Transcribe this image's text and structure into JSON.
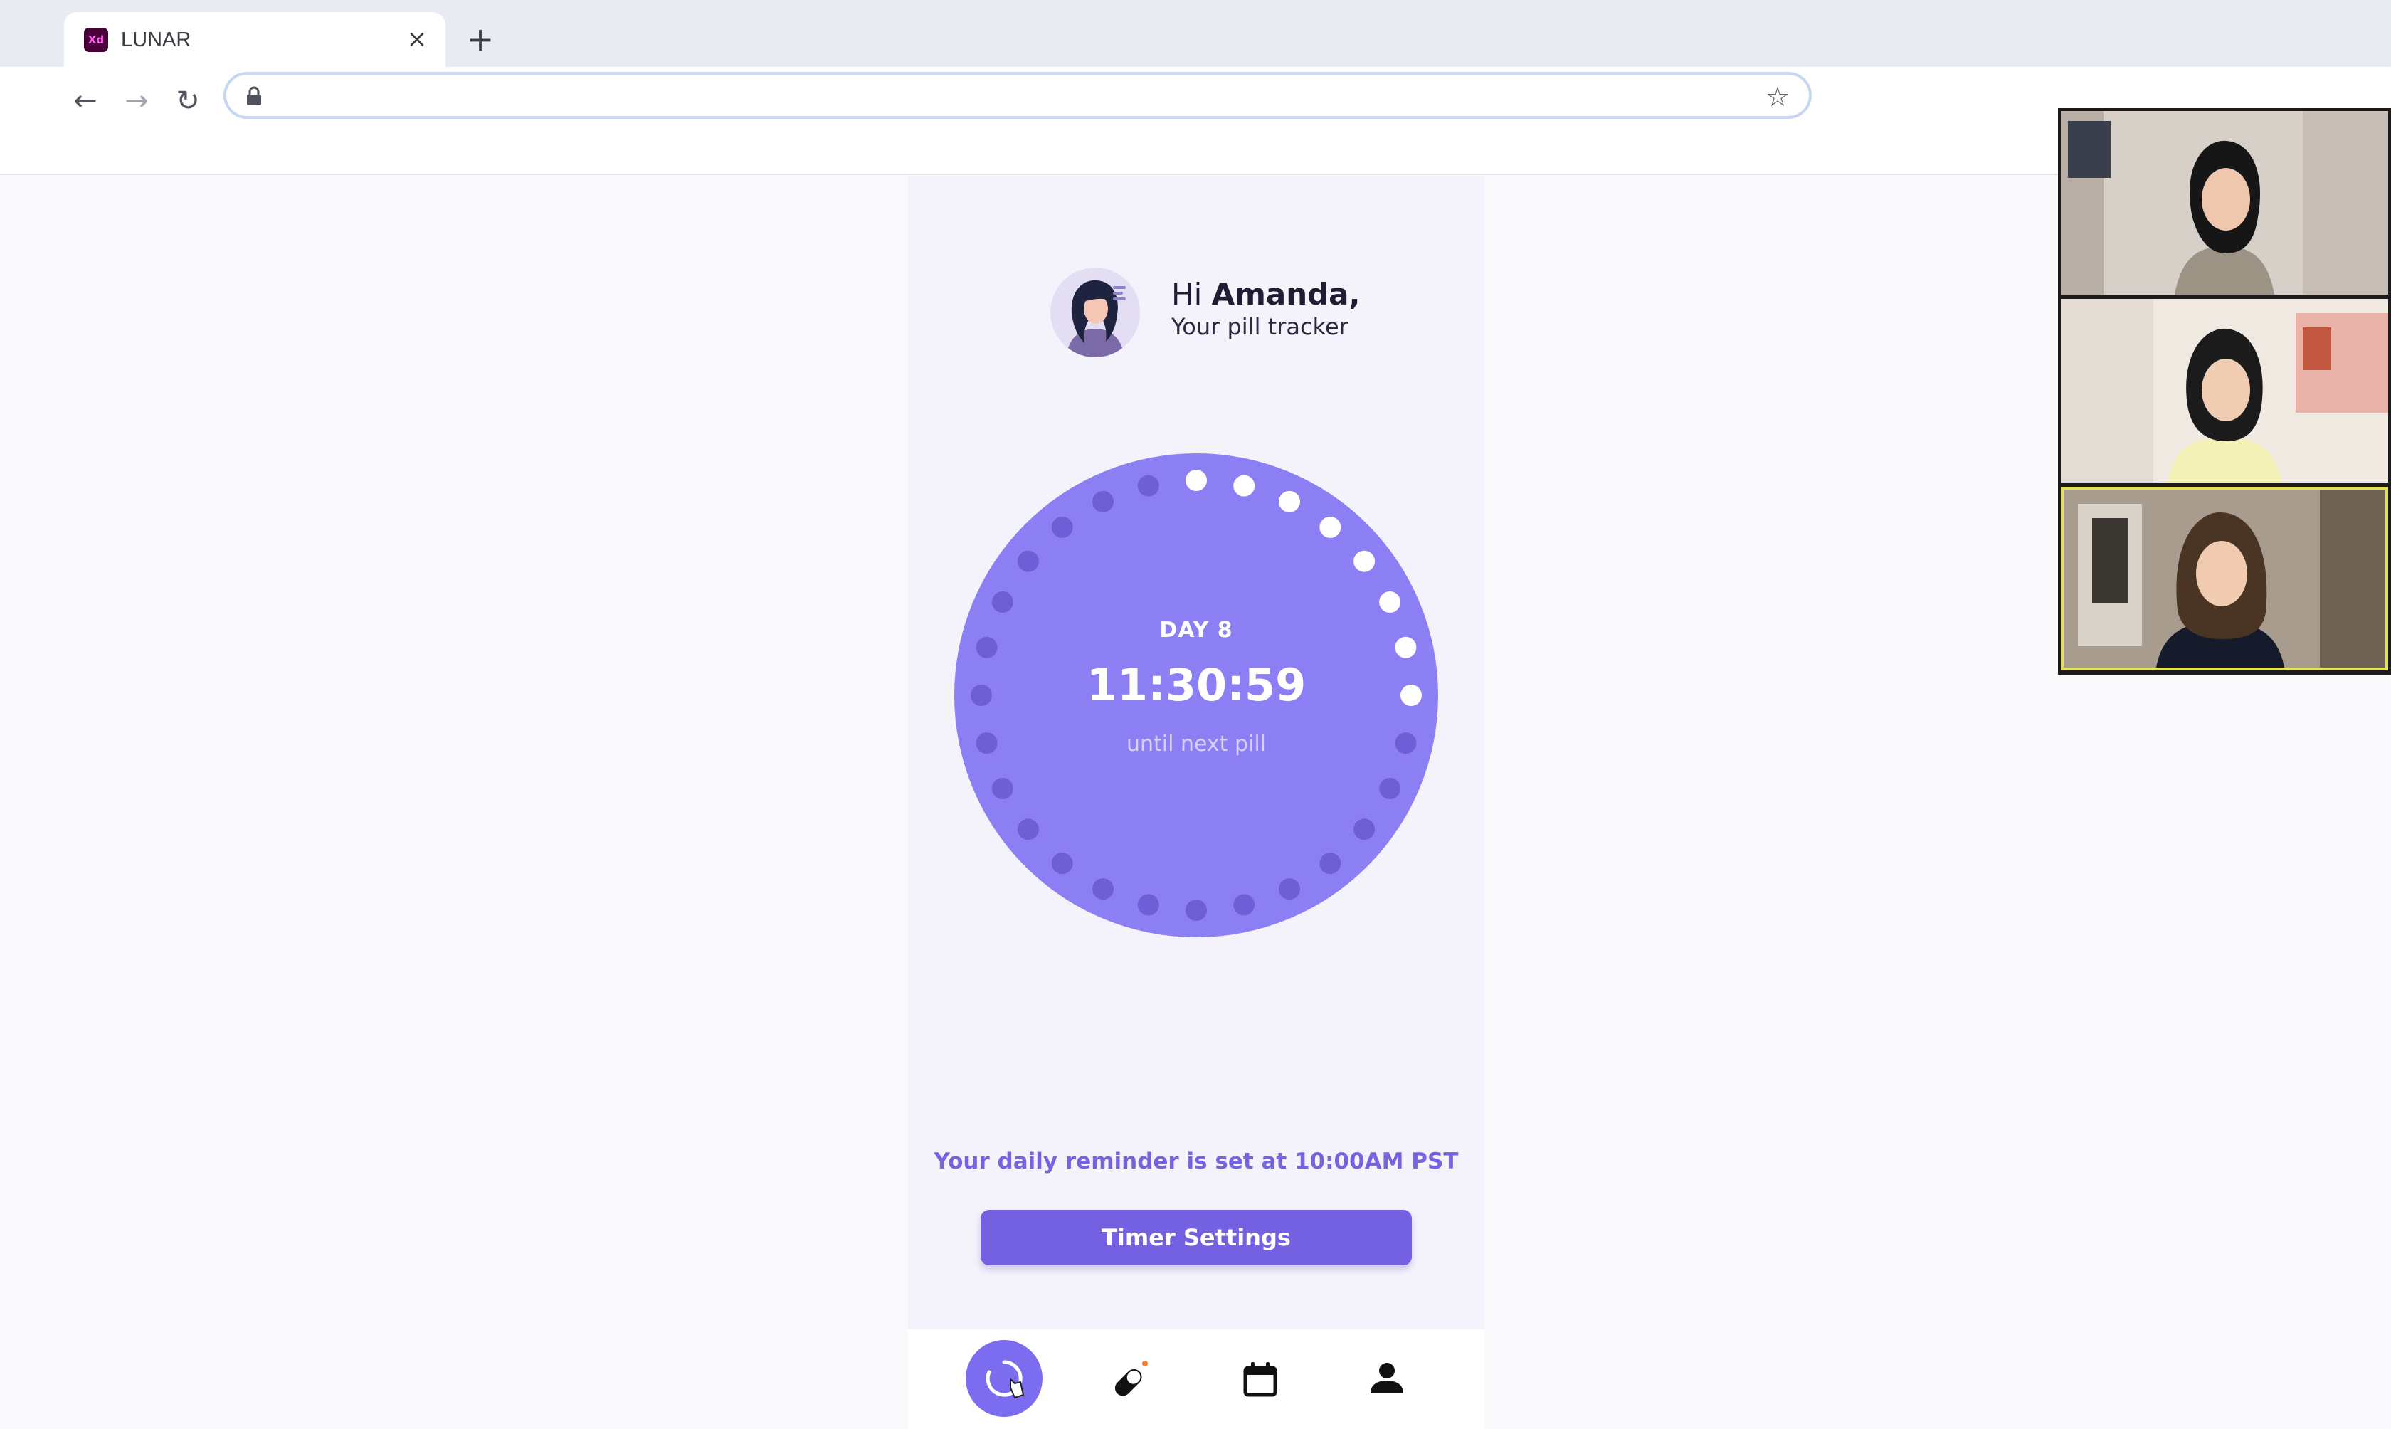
{
  "browser": {
    "tab_title": "LUNAR",
    "favicon_text": "Xd",
    "close_icon": "close-icon",
    "new_tab_icon": "plus-icon",
    "address": ""
  },
  "app": {
    "greeting_prefix": "Hi ",
    "user_name": "Amanda,",
    "subtitle": "Your pill tracker",
    "dial": {
      "day_label": "DAY 8",
      "countdown": "11:30:59",
      "until_label": "until next pill",
      "total_dots": 28,
      "completed_dots": 8,
      "color_fill": "#8b7ff3",
      "color_dot_done": "#ffffff",
      "color_dot_pending": "#6f5fd6"
    },
    "reminder_text": "Your daily reminder is set at 10:00AM PST",
    "timer_button": "Timer Settings",
    "nav": [
      {
        "icon": "timer-icon",
        "active": true
      },
      {
        "icon": "pill-icon",
        "active": false
      },
      {
        "icon": "calendar-icon",
        "active": false
      },
      {
        "icon": "profile-icon",
        "active": false
      }
    ]
  },
  "video_call": {
    "participants": 3,
    "active_speaker": 3
  },
  "colors": {
    "accent": "#7361e2",
    "active_speaker_border": "#e6e15a"
  }
}
